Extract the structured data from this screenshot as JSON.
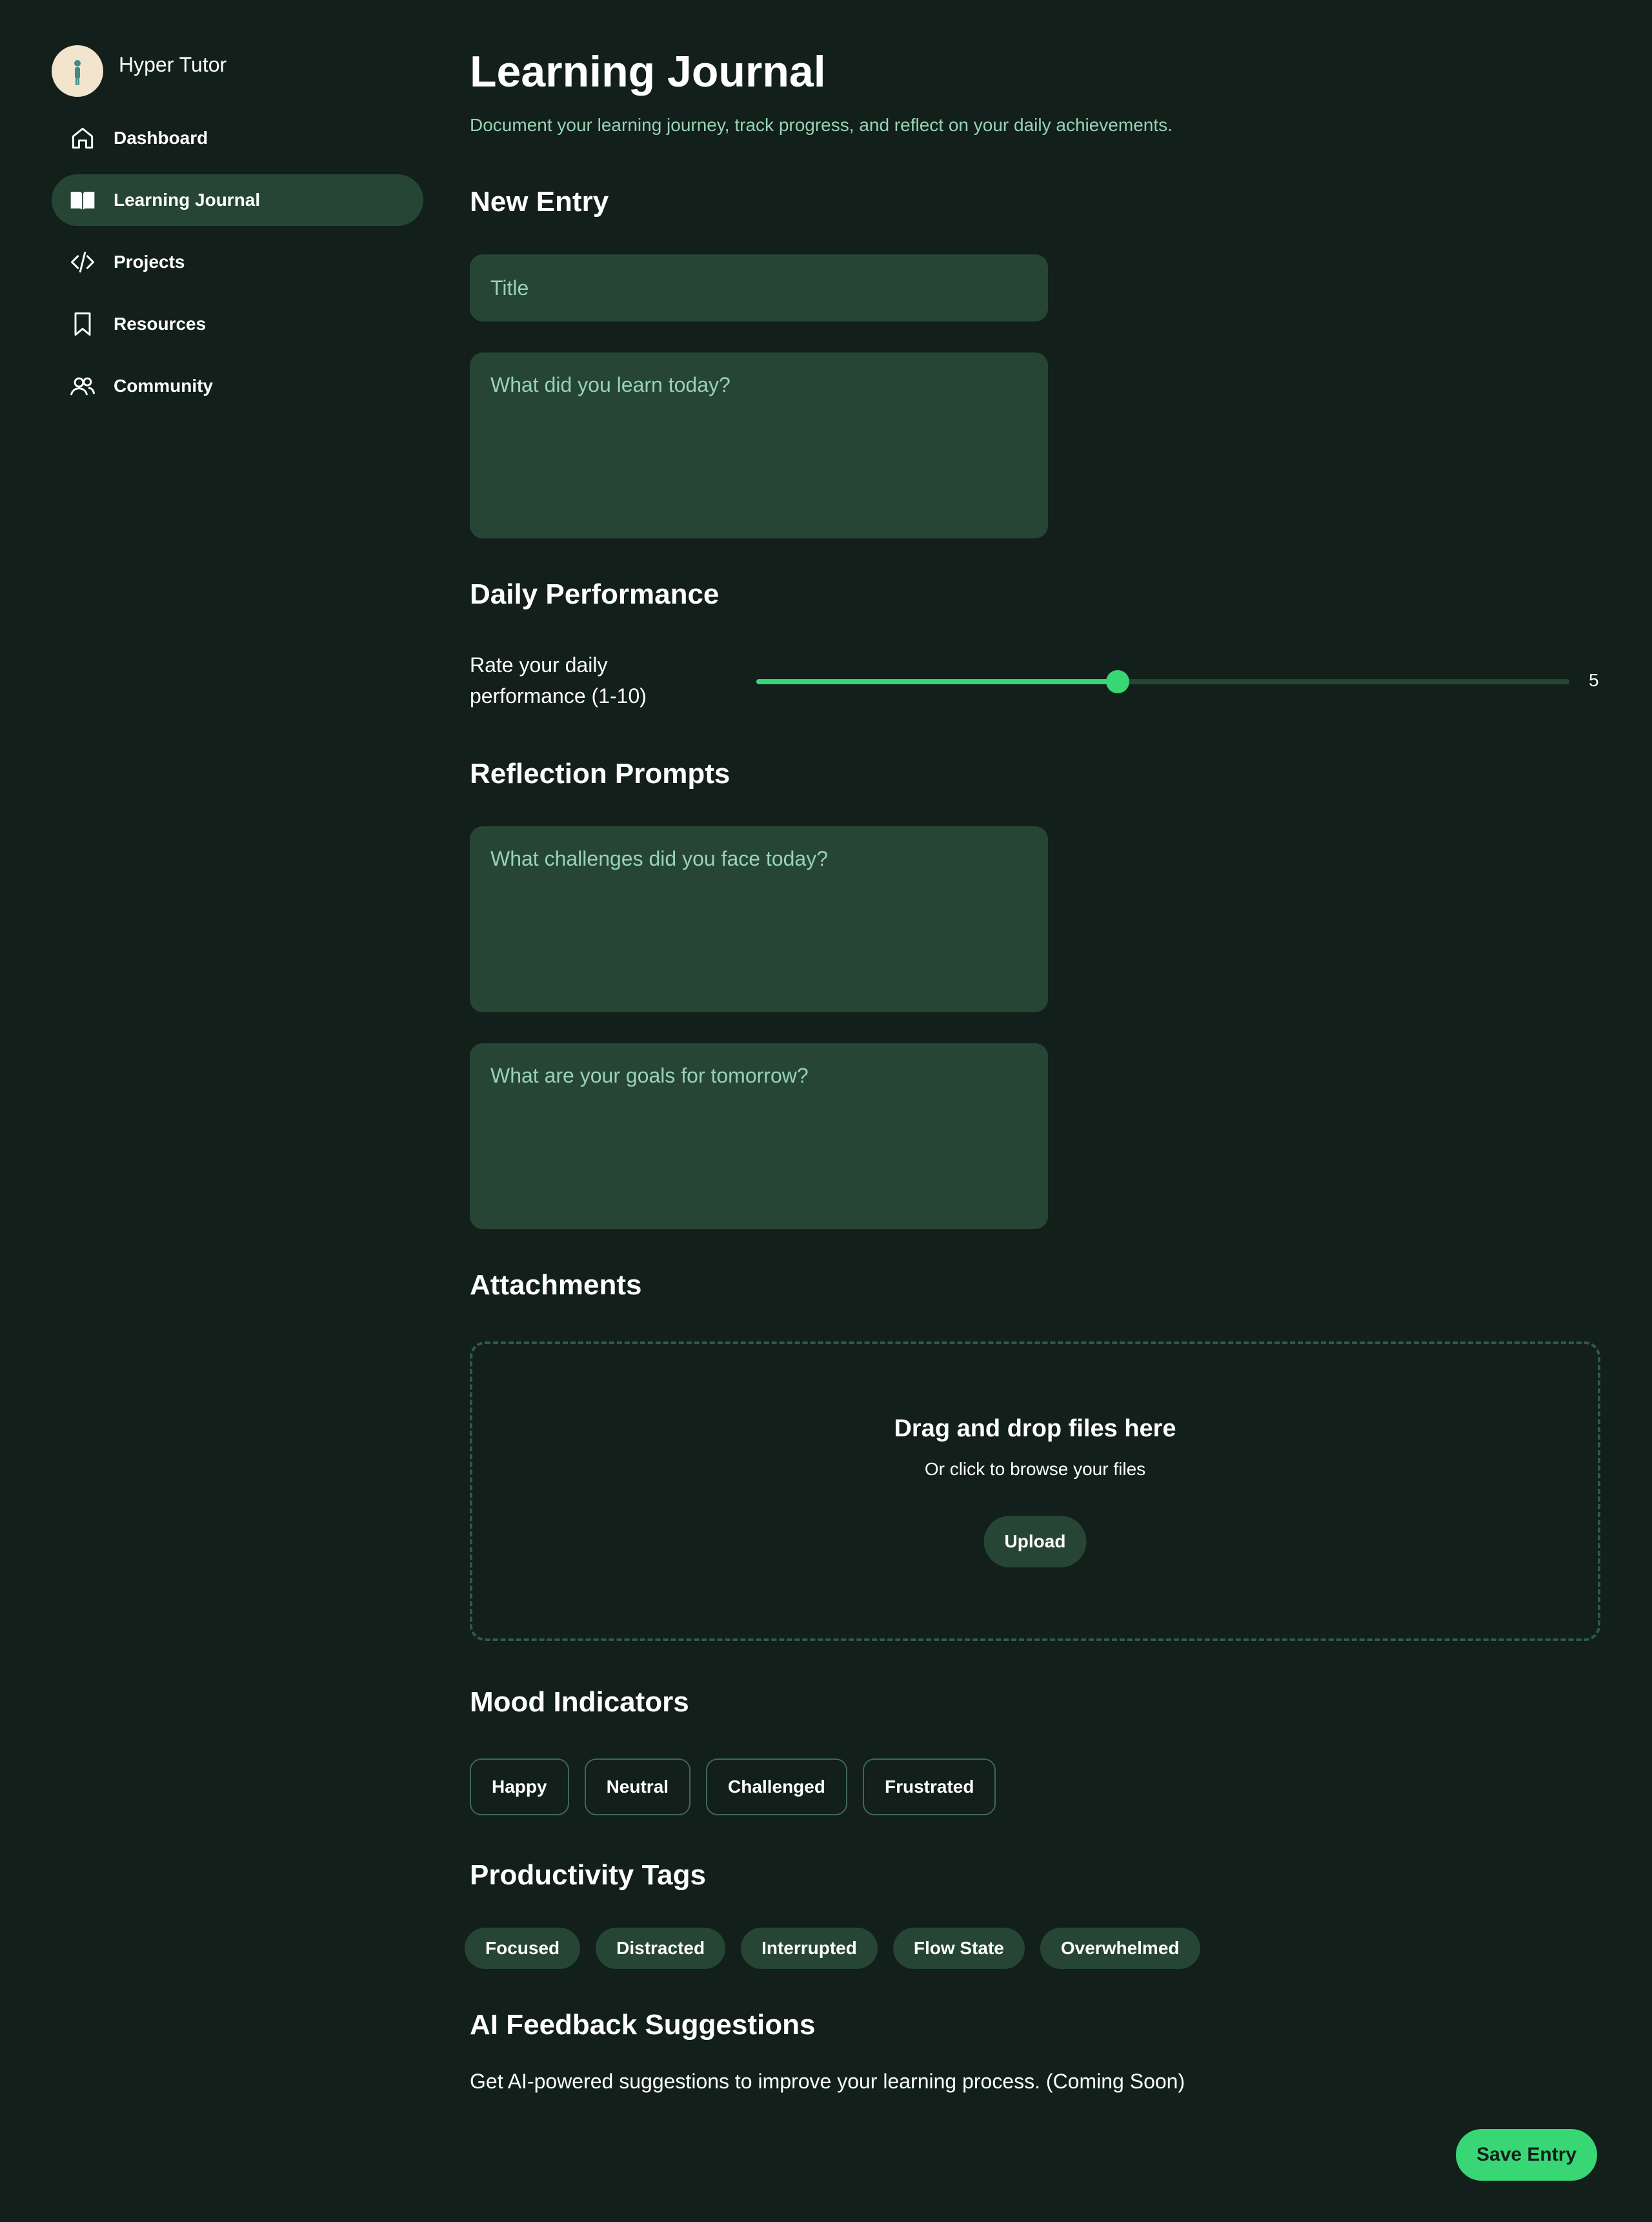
{
  "app": {
    "name": "Hyper Tutor"
  },
  "sidebar": {
    "items": [
      {
        "label": "Dashboard",
        "icon": "home-icon"
      },
      {
        "label": "Learning Journal",
        "icon": "book-open-icon",
        "active": true
      },
      {
        "label": "Projects",
        "icon": "code-icon"
      },
      {
        "label": "Resources",
        "icon": "bookmark-icon"
      },
      {
        "label": "Community",
        "icon": "users-icon"
      }
    ]
  },
  "header": {
    "title": "Learning Journal",
    "subtitle": "Document your learning journey, track progress, and reflect on your daily achievements."
  },
  "new_entry": {
    "title": "New Entry",
    "title_placeholder": "Title",
    "body_placeholder": "What did you learn today?"
  },
  "performance": {
    "title": "Daily Performance",
    "label": "Rate your daily performance (1-10)",
    "value": "5",
    "min": 1,
    "max": 10
  },
  "reflection": {
    "title": "Reflection Prompts",
    "challenges_placeholder": "What challenges did you face today?",
    "goals_placeholder": "What are your goals for tomorrow?"
  },
  "attachments": {
    "title": "Attachments",
    "drop_title": "Drag and drop files here",
    "drop_subtitle": "Or click to browse your files",
    "upload_label": "Upload"
  },
  "mood": {
    "title": "Mood Indicators",
    "options": [
      "Happy",
      "Neutral",
      "Challenged",
      "Frustrated"
    ]
  },
  "productivity": {
    "title": "Productivity Tags",
    "tags": [
      "Focused",
      "Distracted",
      "Interrupted",
      "Flow State",
      "Overwhelmed"
    ]
  },
  "ai_feedback": {
    "title": "AI Feedback Suggestions",
    "text": "Get AI-powered suggestions to improve your learning process. (Coming Soon)"
  },
  "actions": {
    "save_label": "Save Entry"
  },
  "colors": {
    "background": "#121f1a",
    "surface": "#274535",
    "accent": "#39d675",
    "muted_text": "#97d3b4"
  }
}
